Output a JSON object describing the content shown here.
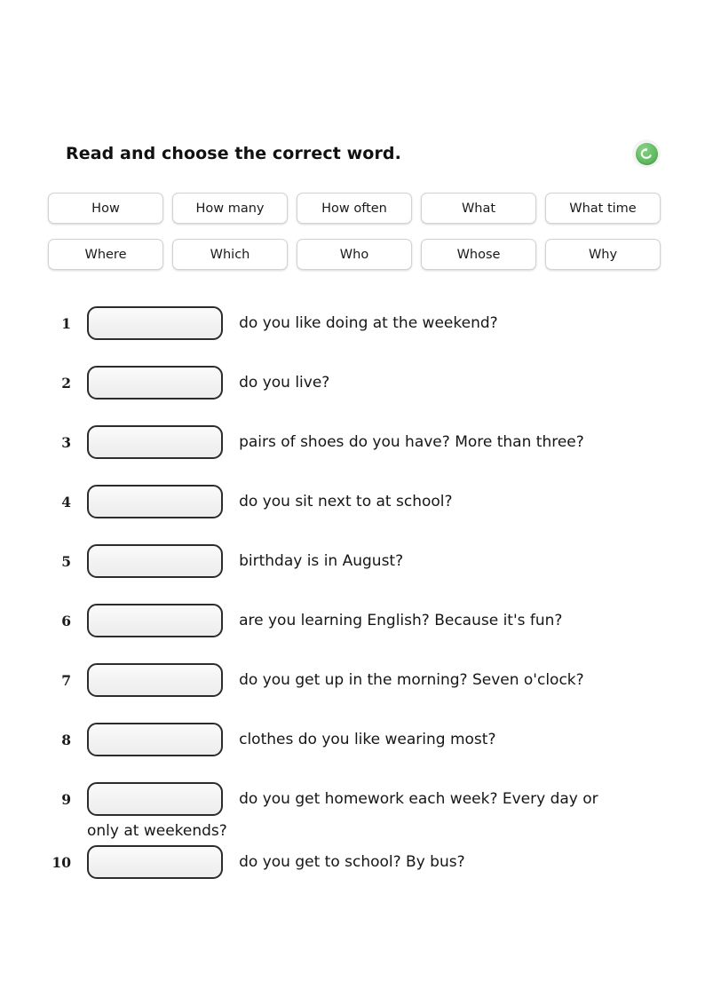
{
  "header": {
    "title": "Read and choose the correct word.",
    "reset_icon": "reset-circular-arrow-icon",
    "reset_color": "#5cb85c"
  },
  "wordbank": {
    "rows": [
      [
        "How",
        "How many",
        "How often",
        "What",
        "What time"
      ],
      [
        "Where",
        "Which",
        "Who",
        "Whose",
        "Why"
      ]
    ]
  },
  "questions": [
    {
      "number": "1",
      "blank_value": "",
      "text": "do you like doing at the weekend?",
      "wrap": ""
    },
    {
      "number": "2",
      "blank_value": "",
      "text": "do you live?",
      "wrap": ""
    },
    {
      "number": "3",
      "blank_value": "",
      "text": "pairs of shoes do you have? More than three?",
      "wrap": ""
    },
    {
      "number": "4",
      "blank_value": "",
      "text": "do you sit next to at school?",
      "wrap": ""
    },
    {
      "number": "5",
      "blank_value": "",
      "text": "birthday is in August?",
      "wrap": ""
    },
    {
      "number": "6",
      "blank_value": "",
      "text": "are you learning English? Because it's fun?",
      "wrap": ""
    },
    {
      "number": "7",
      "blank_value": "",
      "text": "do you get up in the morning? Seven o'clock?",
      "wrap": ""
    },
    {
      "number": "8",
      "blank_value": "",
      "text": "clothes do you like wearing most?",
      "wrap": ""
    },
    {
      "number": "9",
      "blank_value": "",
      "text": "do you get homework each week? Every day or",
      "wrap": "only at weekends?"
    },
    {
      "number": "10",
      "blank_value": "",
      "text": "do you get to school? By bus?",
      "wrap": ""
    }
  ]
}
